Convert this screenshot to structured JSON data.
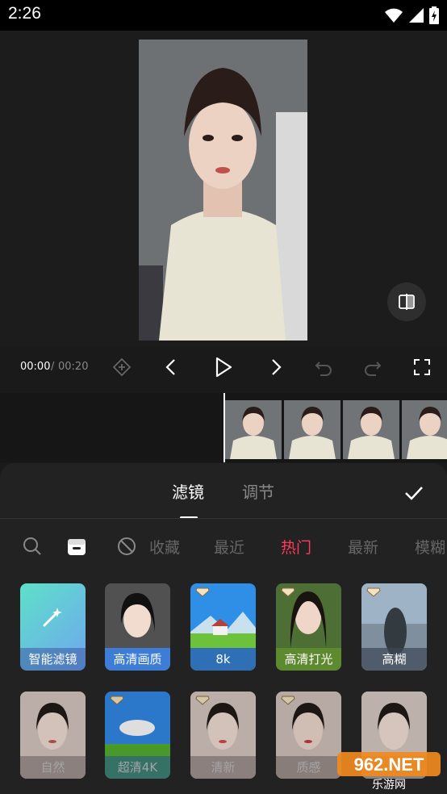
{
  "status": {
    "time": "2:26"
  },
  "playback": {
    "current": "00:00",
    "separator": "/",
    "total": "00:20"
  },
  "panel": {
    "tabs": [
      {
        "label": "滤镜",
        "active": true
      },
      {
        "label": "调节",
        "active": false
      }
    ],
    "categories": [
      {
        "label": "收藏",
        "active": false
      },
      {
        "label": "最近",
        "active": false
      },
      {
        "label": "热门",
        "active": true
      },
      {
        "label": "最新",
        "active": false
      },
      {
        "label": "模糊",
        "active": false
      }
    ],
    "filters_row1": [
      {
        "label": "智能滤镜",
        "vip": false
      },
      {
        "label": "高清画质",
        "vip": false
      },
      {
        "label": "8k",
        "vip": true
      },
      {
        "label": "高清打光",
        "vip": true
      },
      {
        "label": "高糊",
        "vip": true
      }
    ],
    "filters_row2": [
      {
        "label": "自然",
        "vip": false
      },
      {
        "label": "超清4K",
        "vip": true
      },
      {
        "label": "清新",
        "vip": true
      },
      {
        "label": "质感",
        "vip": true
      },
      {
        "label": "",
        "vip": false
      }
    ]
  },
  "watermark": {
    "text": "962.NET",
    "subtext": "乐游网"
  },
  "colors": {
    "accent": "#ff3b5c",
    "background": "#1a1a1a",
    "panel": "#222222"
  }
}
